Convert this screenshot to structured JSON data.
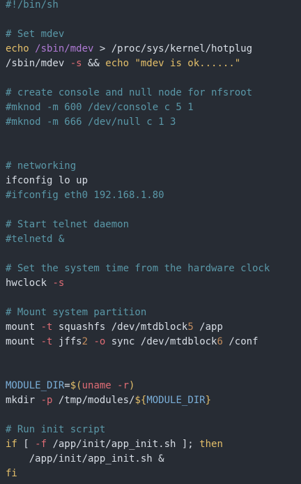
{
  "code": {
    "lines": [
      [
        {
          "t": "#!/bin/sh",
          "c": "comment"
        }
      ],
      [],
      [
        {
          "t": "# Set mdev",
          "c": "comment"
        }
      ],
      [
        {
          "t": "echo",
          "c": "builtin"
        },
        {
          "t": " ",
          "c": "plain"
        },
        {
          "t": "/sbin/mdev",
          "c": "path"
        },
        {
          "t": " > /proc/sys/kernel/hotplug",
          "c": "plain"
        }
      ],
      [
        {
          "t": "/sbin/mdev ",
          "c": "plain"
        },
        {
          "t": "-s",
          "c": "flag"
        },
        {
          "t": " && ",
          "c": "plain"
        },
        {
          "t": "echo",
          "c": "builtin"
        },
        {
          "t": " ",
          "c": "plain"
        },
        {
          "t": "\"mdev is ok......\"",
          "c": "string"
        }
      ],
      [],
      [
        {
          "t": "# create console and null node for nfsroot",
          "c": "comment"
        }
      ],
      [
        {
          "t": "#mknod -m 600 /dev/console c 5 1",
          "c": "comment"
        }
      ],
      [
        {
          "t": "#mknod -m 666 /dev/null c 1 3",
          "c": "comment"
        }
      ],
      [],
      [],
      [
        {
          "t": "# networking",
          "c": "comment"
        }
      ],
      [
        {
          "t": "ifconfig lo up",
          "c": "plain"
        }
      ],
      [
        {
          "t": "#ifconfig eth0 192.168.1.80",
          "c": "comment"
        }
      ],
      [],
      [
        {
          "t": "# Start telnet daemon",
          "c": "comment"
        }
      ],
      [
        {
          "t": "#telnetd &",
          "c": "comment"
        }
      ],
      [],
      [
        {
          "t": "# Set the system time from the hardware clock",
          "c": "comment"
        }
      ],
      [
        {
          "t": "hwclock ",
          "c": "plain"
        },
        {
          "t": "-s",
          "c": "flag"
        }
      ],
      [],
      [
        {
          "t": "# Mount system partition",
          "c": "comment"
        }
      ],
      [
        {
          "t": "mount ",
          "c": "plain"
        },
        {
          "t": "-t",
          "c": "flag"
        },
        {
          "t": " squashfs /dev/mtdblock",
          "c": "plain"
        },
        {
          "t": "5",
          "c": "number"
        },
        {
          "t": " /app",
          "c": "plain"
        }
      ],
      [
        {
          "t": "mount ",
          "c": "plain"
        },
        {
          "t": "-t",
          "c": "flag"
        },
        {
          "t": " jffs",
          "c": "plain"
        },
        {
          "t": "2",
          "c": "number"
        },
        {
          "t": " ",
          "c": "plain"
        },
        {
          "t": "-o",
          "c": "flag"
        },
        {
          "t": " sync /dev/mtdblock",
          "c": "plain"
        },
        {
          "t": "6",
          "c": "number"
        },
        {
          "t": " /conf",
          "c": "plain"
        }
      ],
      [],
      [],
      [
        {
          "t": "MODULE_DIR",
          "c": "var"
        },
        {
          "t": "=",
          "c": "op"
        },
        {
          "t": "$(",
          "c": "builtin"
        },
        {
          "t": "uname ",
          "c": "flag"
        },
        {
          "t": "-r",
          "c": "flag"
        },
        {
          "t": ")",
          "c": "builtin"
        }
      ],
      [
        {
          "t": "mkdir ",
          "c": "plain"
        },
        {
          "t": "-p",
          "c": "flag"
        },
        {
          "t": " /tmp/modules/",
          "c": "plain"
        },
        {
          "t": "${",
          "c": "builtin"
        },
        {
          "t": "MODULE_DIR",
          "c": "var"
        },
        {
          "t": "}",
          "c": "builtin"
        }
      ],
      [],
      [
        {
          "t": "# Run init script",
          "c": "comment"
        }
      ],
      [
        {
          "t": "if",
          "c": "keyword"
        },
        {
          "t": " [ ",
          "c": "plain"
        },
        {
          "t": "-f",
          "c": "flag"
        },
        {
          "t": " /app/init/app_init.sh ]; ",
          "c": "plain"
        },
        {
          "t": "then",
          "c": "keyword"
        }
      ],
      [
        {
          "t": "    /app/init/app_init.sh &",
          "c": "plain"
        }
      ],
      [
        {
          "t": "fi",
          "c": "keyword"
        }
      ]
    ]
  },
  "colors": {
    "background": "#272c34",
    "comment": "#5a98a8",
    "plain": "#d8dee6",
    "builtin": "#e4bf6a",
    "path": "#b17bd6",
    "flag": "#df6c75",
    "number": "#c38d5e",
    "var": "#7aaed8"
  }
}
